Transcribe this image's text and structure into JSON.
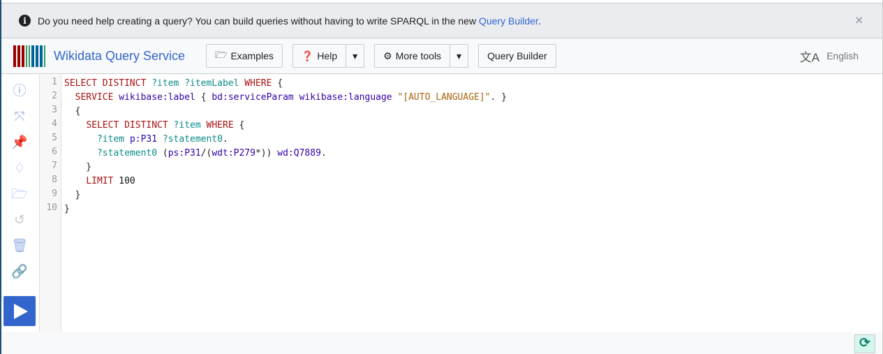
{
  "banner": {
    "text": "Do you need help creating a query? You can build queries without having to write SPARQL in the new ",
    "link": "Query Builder",
    "suffix": ".",
    "close": "×"
  },
  "header": {
    "title": "Wikidata Query Service",
    "examples": "Examples",
    "help": "Help",
    "more_tools": "More tools",
    "query_builder": "Query Builder",
    "language": "English"
  },
  "colors": {
    "accent": "#3366cc",
    "logo": [
      "#990000",
      "#990000",
      "#990000",
      "#339966",
      "#339966",
      "#006699",
      "#006699",
      "#006699",
      "#339966"
    ]
  },
  "sidebar": [
    "info-icon",
    "expand-icon",
    "pin-icon",
    "gem-icon",
    "folder-open-icon",
    "history-icon",
    "trash-icon",
    "link-icon"
  ],
  "editor": {
    "line_numbers": [
      "1",
      "2",
      "3",
      "4",
      "5",
      "6",
      "7",
      "8",
      "9",
      "10"
    ],
    "lines": [
      [
        [
          "SELECT DISTINCT ",
          "kw"
        ],
        [
          "?item ?itemLabel ",
          "var"
        ],
        [
          "WHERE ",
          "kw"
        ],
        [
          "{",
          "pn"
        ]
      ],
      [
        [
          "  ",
          "pn"
        ],
        [
          "SERVICE ",
          "kw"
        ],
        [
          "wikibase:label ",
          "pfx"
        ],
        [
          "{ ",
          "pn"
        ],
        [
          "bd:serviceParam wikibase:language ",
          "pfx"
        ],
        [
          "\"[AUTO_LANGUAGE]\"",
          "str"
        ],
        [
          ". }",
          "pn"
        ]
      ],
      [
        [
          "  {",
          "pn"
        ]
      ],
      [
        [
          "    ",
          "pn"
        ],
        [
          "SELECT DISTINCT ",
          "kw"
        ],
        [
          "?item ",
          "var"
        ],
        [
          "WHERE ",
          "kw"
        ],
        [
          "{",
          "pn"
        ]
      ],
      [
        [
          "      ",
          "pn"
        ],
        [
          "?item ",
          "var"
        ],
        [
          "p:P31 ",
          "pfx"
        ],
        [
          "?statement0",
          "var"
        ],
        [
          ".",
          "pn"
        ]
      ],
      [
        [
          "      ",
          "pn"
        ],
        [
          "?statement0 ",
          "var"
        ],
        [
          "(",
          "pn"
        ],
        [
          "ps:P31",
          "pfx"
        ],
        [
          "/(",
          "pn"
        ],
        [
          "wdt:P279",
          "pfx"
        ],
        [
          "*)) ",
          "pn"
        ],
        [
          "wd:Q7889",
          "pfx"
        ],
        [
          ".",
          "pn"
        ]
      ],
      [
        [
          "    }",
          "pn"
        ]
      ],
      [
        [
          "    ",
          "pn"
        ],
        [
          "LIMIT ",
          "kw"
        ],
        [
          "100",
          "num"
        ]
      ],
      [
        [
          "  }",
          "pn"
        ]
      ],
      [
        [
          "}",
          "pn"
        ]
      ]
    ]
  }
}
